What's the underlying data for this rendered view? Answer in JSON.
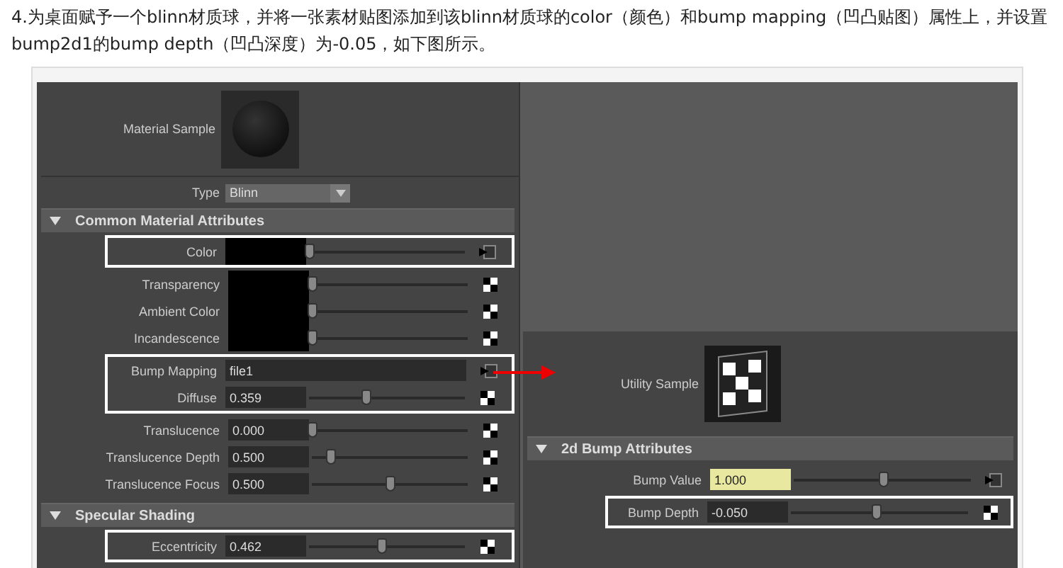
{
  "intro": "4.为桌面赋予一个blinn材质球，并将一张素材贴图添加到该blinn材质球的color（颜色）和bump mapping（凹凸贴图）属性上，并设置bump2d1的bump depth（凹凸深度）为-0.05，如下图所示。",
  "material_panel": {
    "sample_label": "Material Sample",
    "type": {
      "label": "Type",
      "value": "Blinn"
    },
    "sections": [
      {
        "title": "Common Material Attributes",
        "expanded": true,
        "groups": [
          {
            "highlighted": true,
            "rows": [
              {
                "kind": "color",
                "label": "Color",
                "level": 0,
                "connected": true
              }
            ]
          },
          {
            "highlighted": false,
            "rows": [
              {
                "kind": "color",
                "label": "Transparency",
                "level": 0,
                "connected": false
              },
              {
                "kind": "color",
                "label": "Ambient Color",
                "level": 0,
                "connected": false
              },
              {
                "kind": "color",
                "label": "Incandescence",
                "level": 0,
                "connected": false
              }
            ]
          },
          {
            "highlighted": true,
            "rows": [
              {
                "kind": "text",
                "label": "Bump Mapping",
                "value": "file1",
                "connected": true
              },
              {
                "kind": "number",
                "label": "Diffuse",
                "value": "0.359",
                "level": 0.36,
                "connected": false,
                "field_highlight": false
              }
            ]
          },
          {
            "highlighted": false,
            "rows": [
              {
                "kind": "number",
                "label": "Translucence",
                "value": "0.000",
                "level": 0,
                "connected": false,
                "field_highlight": false
              },
              {
                "kind": "number",
                "label": "Translucence Depth",
                "value": "0.500",
                "level": 0.12,
                "connected": false,
                "field_highlight": false
              },
              {
                "kind": "number",
                "label": "Translucence Focus",
                "value": "0.500",
                "level": 0.5,
                "connected": false,
                "field_highlight": false
              }
            ]
          }
        ]
      },
      {
        "title": "Specular Shading",
        "expanded": true,
        "groups": [
          {
            "highlighted": true,
            "rows": [
              {
                "kind": "number",
                "label": "Eccentricity",
                "value": "0.462",
                "level": 0.46,
                "connected": false,
                "field_highlight": false
              }
            ]
          }
        ]
      }
    ]
  },
  "utility_panel": {
    "sample_label": "Utility Sample",
    "sections": [
      {
        "title": "2d Bump Attributes",
        "expanded": true,
        "groups": [
          {
            "highlighted": false,
            "rows": [
              {
                "kind": "number",
                "label": "Bump Value",
                "value": "1.000",
                "level": 0.5,
                "connected": true,
                "field_highlight": true
              }
            ]
          },
          {
            "highlighted": true,
            "rows": [
              {
                "kind": "number",
                "label": "Bump Depth",
                "value": "-0.050",
                "level": 0.48,
                "connected": false,
                "field_highlight": false
              }
            ]
          }
        ]
      }
    ]
  }
}
